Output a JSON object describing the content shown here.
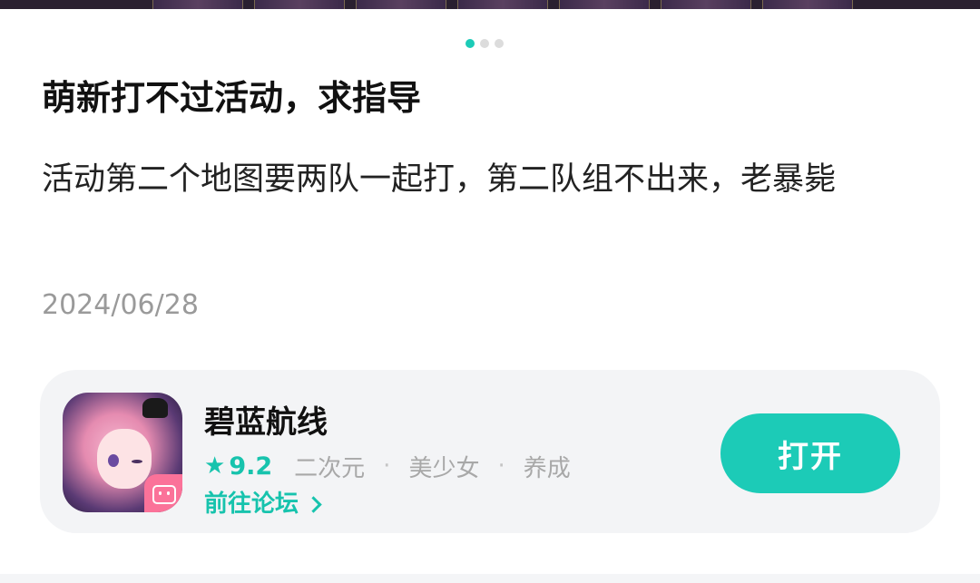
{
  "carousel": {
    "page_count": 3,
    "active_index": 0
  },
  "post": {
    "title": "萌新打不过活动，求指导",
    "body": "活动第二个地图要两队一起打，第二队组不出来，老暴毙",
    "date": "2024/06/28"
  },
  "app_card": {
    "name": "碧蓝航线",
    "icon": "app-icon-azur-lane",
    "rating": "9.2",
    "tags": [
      "二次元",
      "美少女",
      "养成"
    ],
    "separator": "·",
    "forum_link_label": "前往论坛",
    "open_button_label": "打开"
  },
  "colors": {
    "accent": "#1ccbb7",
    "badge": "#fb7299",
    "card_bg": "#f3f4f6",
    "date_text": "#9a9a9a"
  }
}
